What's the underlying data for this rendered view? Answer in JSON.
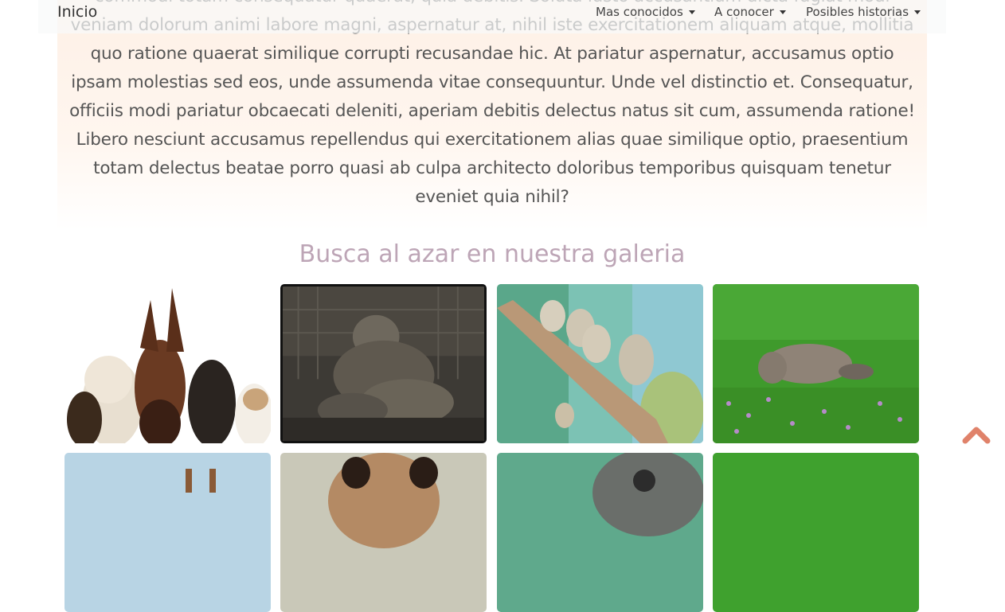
{
  "intro": {
    "paragraph": "commodi totam consequatur quaerat, quia debitis. Soluta iusto accusantium dicta fugiat modi veniam dolorum animi labore magni, aspernatur at, nihil iste exercitationem aliquam atque, mollitia quo ratione quaerat similique corrupti recusandae hic. At pariatur aspernatur, accusamus optio ipsam molestias sed eos, unde assumenda vitae consequuntur. Unde vel distinctio et. Consequatur, officiis modi pariatur obcaecati deleniti, aperiam debitis delectus natus sit cum, assumenda ratione! Libero nesciunt accusamus repellendus qui exercitationem alias quae similique optio, praesentium totam delectus beatae porro quasi ab culpa architecto doloribus temporibus quisquam tenetur eveniet quia nihil?"
  },
  "navbar": {
    "brand": "Inicio",
    "items": [
      {
        "label": "Mas conocidos"
      },
      {
        "label": "A conocer"
      },
      {
        "label": "Posibles historias"
      }
    ]
  },
  "gallery": {
    "title": "Busca al azar en nuestra galeria",
    "images": [
      {
        "name": "dogs-photo"
      },
      {
        "name": "chimpanzee-photo"
      },
      {
        "name": "monkeys-on-branch-photo"
      },
      {
        "name": "elephant-in-grass-photo"
      },
      {
        "name": "giraffes-photo"
      },
      {
        "name": "opossum-photo"
      },
      {
        "name": "gorilla-photo"
      },
      {
        "name": "grass-animal-photo"
      }
    ]
  },
  "colors": {
    "title": "#bda5b6",
    "scroll_button": "#e0826a",
    "intro_background": "#fdf0e6"
  },
  "icons": {
    "scroll_top": "chevron-up-icon"
  }
}
